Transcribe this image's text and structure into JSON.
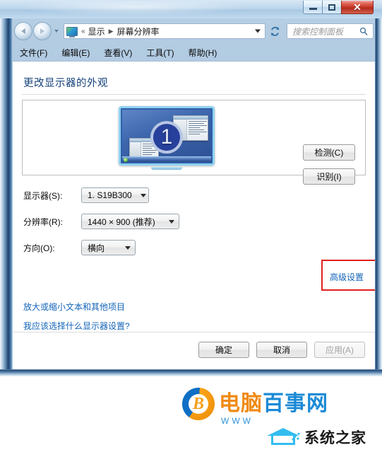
{
  "window": {
    "controls": {
      "minimize_label": "–",
      "maximize_label": "",
      "close_label": "✕"
    }
  },
  "address_bar": {
    "icon": "display-monitor-icon",
    "overflow_chevrons": "«",
    "crumbs": [
      "显示",
      "屏幕分辨率"
    ],
    "separator": "▶",
    "dropdown_icon": "chevron-down-icon",
    "refresh_icon": "↺"
  },
  "search": {
    "placeholder": "搜索控制面板",
    "value": ""
  },
  "menu": {
    "items": [
      "文件(F)",
      "编辑(E)",
      "查看(V)",
      "工具(T)",
      "帮助(H)"
    ]
  },
  "main": {
    "heading": "更改显示器的外观",
    "preview": {
      "monitor_number": "1"
    },
    "side_buttons": [
      {
        "label": "检测(C)",
        "name": "detect-button"
      },
      {
        "label": "识别(I)",
        "name": "identify-button"
      }
    ],
    "fields": [
      {
        "label": "显示器(S):",
        "value": "1. S19B300",
        "name": "display-select"
      },
      {
        "label": "分辨率(R):",
        "value": "1440 × 900 (推荐)",
        "name": "resolution-select"
      },
      {
        "label": "方向(O):",
        "value": "横向",
        "name": "orientation-select"
      }
    ],
    "advanced_link": "高级设置",
    "links": [
      "放大或缩小文本和其他项目",
      "我应该选择什么显示器设置?"
    ],
    "dialog_buttons": [
      {
        "label": "确定",
        "name": "ok-button",
        "disabled": false
      },
      {
        "label": "取消",
        "name": "cancel-button",
        "disabled": false
      },
      {
        "label": "应用(A)",
        "name": "apply-button",
        "disabled": true
      }
    ]
  },
  "annotation": {
    "highlight_color": "#e02020"
  },
  "watermarks": {
    "primary": {
      "text_orange": "电脑",
      "text_blue": "百事网",
      "url": "WWW"
    },
    "secondary": {
      "text": "系统之家"
    }
  },
  "colors": {
    "heading": "#16427a",
    "link": "#1364b8",
    "accent_red": "#e02020",
    "monitor_badge": "#27409b"
  }
}
